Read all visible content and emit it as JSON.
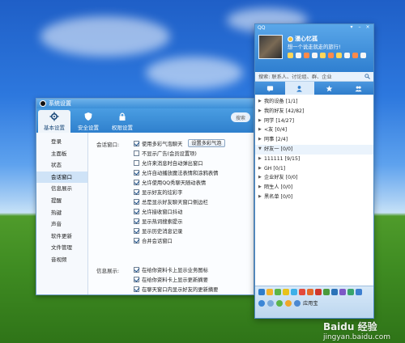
{
  "settings_window": {
    "title": "系统设置",
    "toolbar": [
      {
        "label": "基本设置",
        "icon": "gear-icon",
        "active": true
      },
      {
        "label": "安全设置",
        "icon": "shield-icon",
        "active": false
      },
      {
        "label": "权限设置",
        "icon": "lock-icon",
        "active": false
      }
    ],
    "search_placeholder": "搜索",
    "nav": [
      "登录",
      "主面板",
      "状态",
      "会话窗口",
      "信息展示",
      "提醒",
      "热键",
      "声音",
      "软件更新",
      "文件管理",
      "音视频"
    ],
    "active_nav": "会话窗口",
    "sections": {
      "chat_window_label": "会话窗口:",
      "info_display_label": "信息展示:"
    },
    "chat_options": [
      {
        "label": "使用多彩气泡聊天",
        "checked": true
      },
      {
        "label": "不显示广告(会员设置项)",
        "checked": false
      },
      {
        "label": "允许来消息时自动弹出窗口",
        "checked": false
      },
      {
        "label": "允许自动播放魔法表情和涂鸦表情",
        "checked": true
      },
      {
        "label": "允许使用QQ秀聊天随动表情",
        "checked": true
      },
      {
        "label": "显示好友的炫彩字",
        "checked": true
      },
      {
        "label": "总是显示好友聊天窗口侧边栏",
        "checked": true
      },
      {
        "label": "允许接收窗口抖动",
        "checked": true
      },
      {
        "label": "显示热词搜索提示",
        "checked": true
      },
      {
        "label": "显示历史消息记录",
        "checked": true
      },
      {
        "label": "合并会话窗口",
        "checked": true
      }
    ],
    "bubble_button": "设置多彩气泡",
    "info_options": [
      {
        "label": "在给你资料卡上显示业务图标",
        "checked": true
      },
      {
        "label": "在给你资料卡上显示更新摘要",
        "checked": true
      },
      {
        "label": "在聊天窗口内显示好友的更新摘要",
        "checked": true
      }
    ]
  },
  "qq_panel": {
    "app_name": "QQ",
    "nickname": "漫心忆孤",
    "signature": "想一个说走就走的旅行!",
    "search_placeholder": "搜索: 联系人、讨论组、群、企业",
    "tabs": [
      "contacts-tab",
      "friends-tab",
      "favorites-tab",
      "groups-tab"
    ],
    "groups": [
      {
        "name": "我的设备 [1/1]",
        "open": false
      },
      {
        "name": "我的好友 [42/82]",
        "open": false
      },
      {
        "name": "同学 [14/27]",
        "open": false
      },
      {
        "name": "<友 [0/4]",
        "open": false
      },
      {
        "name": "同事 [2/4]",
        "open": false
      },
      {
        "name": "好友一 [0/0]",
        "open": true
      },
      {
        "name": "111111 [9/15]",
        "open": false
      },
      {
        "name": "GH [0/1]",
        "open": false
      },
      {
        "name": "企业好友 [0/0]",
        "open": false
      },
      {
        "name": "陌生人 [0/0]",
        "open": false
      },
      {
        "name": "黑名单 [0/0]",
        "open": false
      }
    ],
    "bottom_label": "应用宝"
  },
  "watermark": {
    "brand": "Baidu 经验",
    "url": "jingyan.baidu.com"
  }
}
